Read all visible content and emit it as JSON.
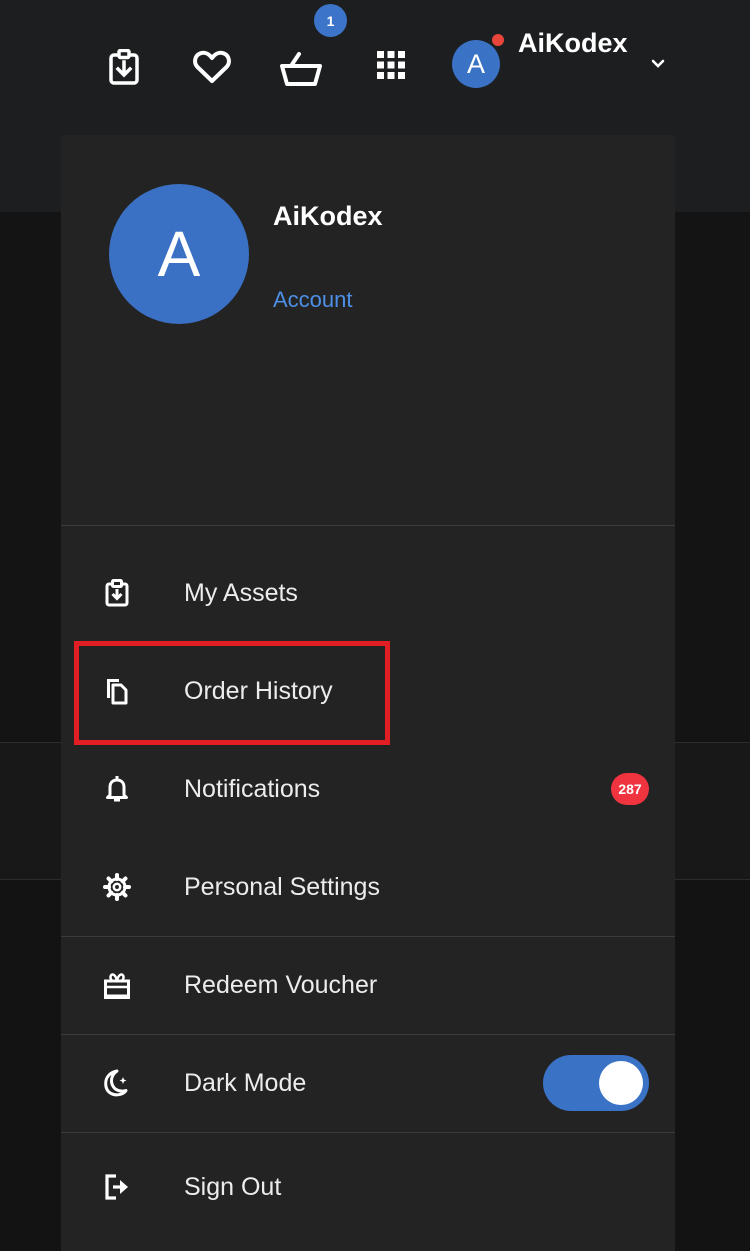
{
  "header": {
    "cart_count": "1",
    "avatar_initial": "A",
    "username": "AiKodex",
    "icons": [
      "download-icon",
      "heart-icon",
      "cart-icon",
      "apps-grid-icon",
      "chevron-down-icon"
    ]
  },
  "profile": {
    "avatar_initial": "A",
    "name": "AiKodex",
    "account_link": "Account"
  },
  "menu": {
    "items": [
      {
        "label": "My Assets",
        "icon": "download-icon"
      },
      {
        "label": "Order History",
        "icon": "copy-icon"
      },
      {
        "label": "Notifications",
        "icon": "bell-icon",
        "badge": "287"
      },
      {
        "label": "Personal Settings",
        "icon": "gear-icon"
      },
      {
        "label": "Redeem Voucher",
        "icon": "gift-icon"
      },
      {
        "label": "Dark Mode",
        "icon": "moon-icon",
        "toggle_on": true
      },
      {
        "label": "Sign Out",
        "icon": "sign-out-icon"
      }
    ]
  },
  "colors": {
    "accent": "#3a72c6",
    "link": "#4d8fe6",
    "badge": "#f0343f",
    "highlight": "#e01e24",
    "panel": "#232323"
  }
}
